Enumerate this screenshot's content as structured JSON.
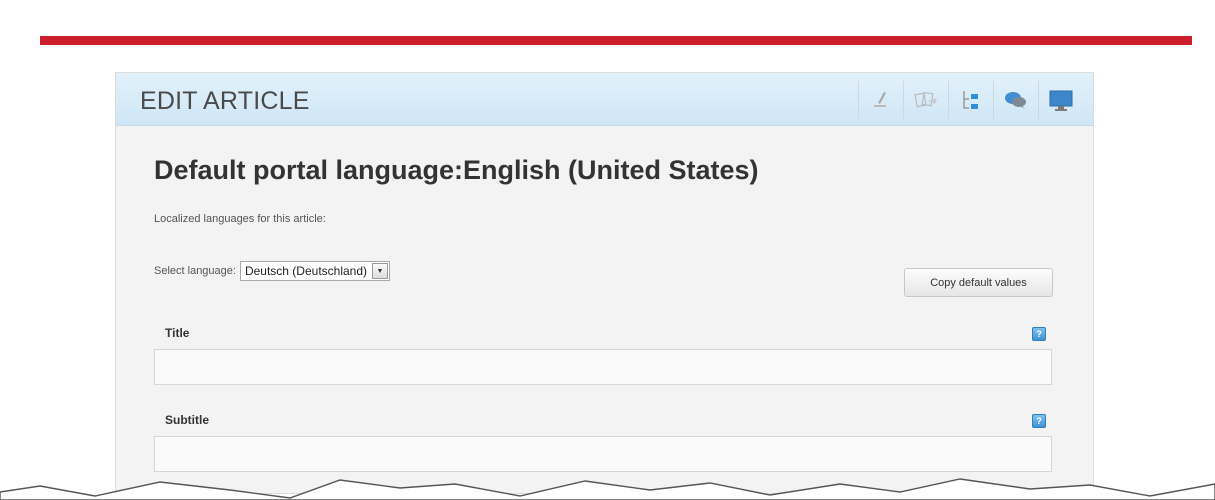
{
  "header": {
    "title": "EDIT ARTICLE",
    "toolbar": [
      {
        "icon": "pencil-icon"
      },
      {
        "icon": "translate-icon"
      },
      {
        "icon": "tree-icon"
      },
      {
        "icon": "comments-icon"
      },
      {
        "icon": "monitor-icon"
      }
    ]
  },
  "main": {
    "heading": "Default portal language:English (United States)",
    "localized_label": "Localized languages for this article:",
    "select_label": "Select language:",
    "selected_language": "Deutsch (Deutschland)",
    "copy_button": "Copy default values",
    "fields": [
      {
        "label": "Title",
        "value": ""
      },
      {
        "label": "Subtitle",
        "value": ""
      }
    ]
  },
  "colors": {
    "accent_red": "#cc1f2b",
    "header_blue": "#d6ebf8",
    "help_blue": "#4a9ad6"
  }
}
